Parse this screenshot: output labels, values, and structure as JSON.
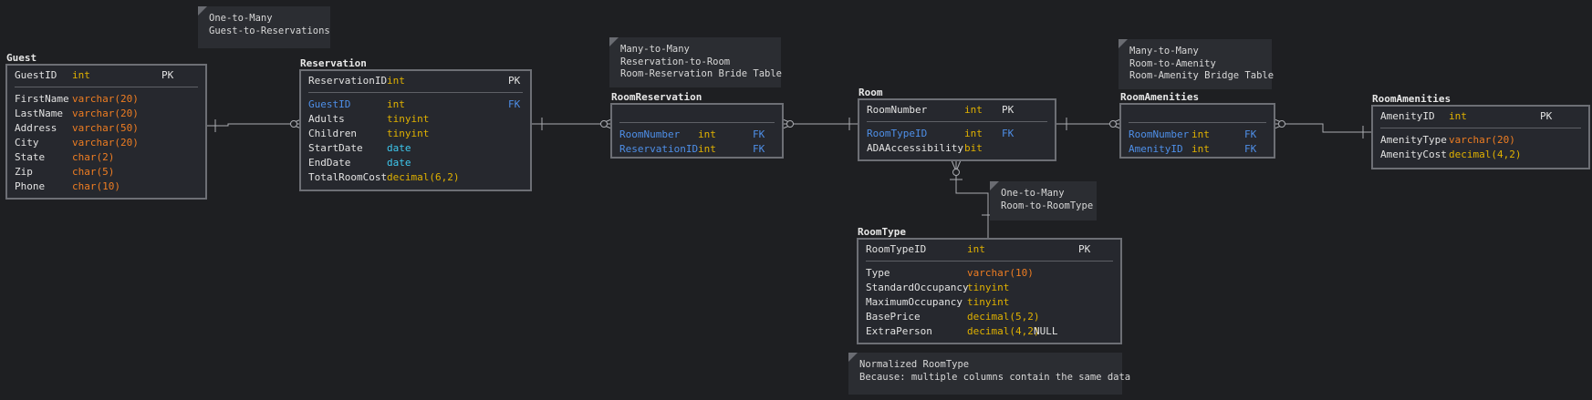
{
  "tables": [
    {
      "id": "guest",
      "title": "Guest",
      "keys": [
        {
          "name": "GuestID",
          "type": "int",
          "type_class": "",
          "key": "PK"
        }
      ],
      "columns": [
        {
          "name": "FirstName",
          "type": "varchar(20)",
          "type_class": "vc"
        },
        {
          "name": "LastName",
          "type": "varchar(20)",
          "type_class": "vc"
        },
        {
          "name": "Address",
          "type": "varchar(50)",
          "type_class": "vc"
        },
        {
          "name": "City",
          "type": "varchar(20)",
          "type_class": "vc"
        },
        {
          "name": "State",
          "type": "char(2)",
          "type_class": "vc"
        },
        {
          "name": "Zip",
          "type": "char(5)",
          "type_class": "vc"
        },
        {
          "name": "Phone",
          "type": "char(10)",
          "type_class": "vc"
        }
      ]
    },
    {
      "id": "reservation",
      "title": "Reservation",
      "keys": [
        {
          "name": "ReservationID",
          "type": "int",
          "type_class": "",
          "key": "PK"
        }
      ],
      "columns": [
        {
          "name": "GuestID",
          "type": "int",
          "type_class": "",
          "key": "FK",
          "fk": true
        },
        {
          "name": "Adults",
          "type": "tinyint",
          "type_class": ""
        },
        {
          "name": "Children",
          "type": "tinyint",
          "type_class": ""
        },
        {
          "name": "StartDate",
          "type": "date",
          "type_class": "dt"
        },
        {
          "name": "EndDate",
          "type": "date",
          "type_class": "dt"
        },
        {
          "name": "TotalRoomCost",
          "type": "decimal(6,2)",
          "type_class": ""
        }
      ]
    },
    {
      "id": "roomreservation",
      "title": "RoomReservation",
      "keys": [],
      "columns": [
        {
          "name": "RoomNumber",
          "type": "int",
          "type_class": "",
          "key": "FK",
          "fk": true
        },
        {
          "name": "ReservationID",
          "type": "int",
          "type_class": "",
          "key": "FK",
          "fk": true
        }
      ]
    },
    {
      "id": "room",
      "title": "Room",
      "keys": [
        {
          "name": "RoomNumber",
          "type": "int",
          "type_class": "",
          "key": "PK"
        }
      ],
      "columns": [
        {
          "name": "RoomTypeID",
          "type": "int",
          "type_class": "",
          "key": "FK",
          "fk": true
        },
        {
          "name": "ADAAccessibility",
          "type": "bit",
          "type_class": ""
        }
      ]
    },
    {
      "id": "roomamenities_bridge",
      "title": "RoomAmenities",
      "keys": [],
      "columns": [
        {
          "name": "RoomNumber",
          "type": "int",
          "type_class": "",
          "key": "FK",
          "fk": true
        },
        {
          "name": "AmenityID",
          "type": "int",
          "type_class": "",
          "key": "FK",
          "fk": true
        }
      ]
    },
    {
      "id": "roomamenities",
      "title": "RoomAmenities",
      "keys": [
        {
          "name": "AmenityID",
          "type": "int",
          "type_class": "",
          "key": "PK"
        }
      ],
      "columns": [
        {
          "name": "AmenityType",
          "type": "varchar(20)",
          "type_class": "vc"
        },
        {
          "name": "AmenityCost",
          "type": "decimal(4,2)",
          "type_class": ""
        }
      ]
    },
    {
      "id": "roomtype",
      "title": "RoomType",
      "keys": [
        {
          "name": "RoomTypeID",
          "type": "int",
          "type_class": "",
          "key": "PK"
        }
      ],
      "columns": [
        {
          "name": "Type",
          "type": "varchar(10)",
          "type_class": "vc"
        },
        {
          "name": "StandardOccupancy",
          "type": "tinyint",
          "type_class": ""
        },
        {
          "name": "MaximumOccupancy",
          "type": "tinyint",
          "type_class": ""
        },
        {
          "name": "BasePrice",
          "type": "decimal(5,2)",
          "type_class": ""
        },
        {
          "name": "ExtraPerson",
          "type": "decimal(4,2)",
          "type_class": "",
          "extra": "NULL"
        }
      ]
    }
  ],
  "notes": [
    {
      "id": "note-guest-reservation",
      "lines": [
        "One-to-Many",
        "Guest-to-Reservations"
      ]
    },
    {
      "id": "note-reservation-room",
      "lines": [
        "Many-to-Many",
        "Reservation-to-Room",
        "Room-Reservation Bride Table"
      ]
    },
    {
      "id": "note-room-amenity",
      "lines": [
        "Many-to-Many",
        "Room-to-Amenity",
        "Room-Amenity Bridge Table"
      ]
    },
    {
      "id": "note-room-roomtype",
      "lines": [
        "One-to-Many",
        "Room-to-RoomType"
      ]
    },
    {
      "id": "note-normalized",
      "lines": [
        "Normalized RoomType",
        "Because: multiple columns contain the same data"
      ]
    }
  ],
  "colors": {
    "background": "#1e1f22",
    "table_border": "#6d6f75",
    "table_fill": "#26282e",
    "fk_blue": "#4e8fe8",
    "type_yellow": "#e0b100",
    "type_orange": "#ee7d22",
    "type_cyan": "#3ec8ee",
    "connector": "#a9abb0"
  }
}
